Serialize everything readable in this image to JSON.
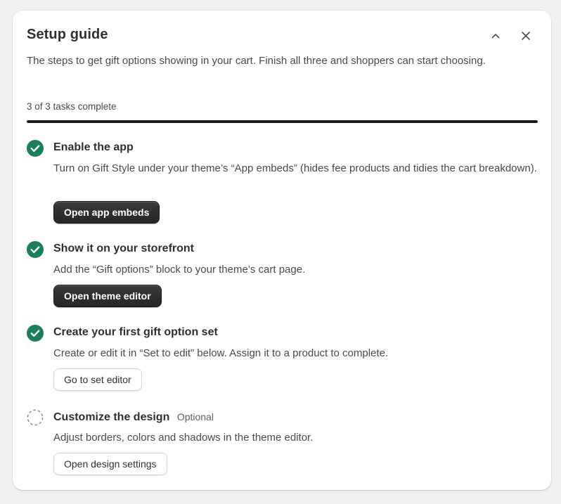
{
  "header": {
    "title": "Setup guide",
    "subtitle": "The steps to get gift options showing in your cart. Finish all three and shoppers can start choosing.",
    "collapse_icon": "chevron-up-icon",
    "close_icon": "close-icon"
  },
  "progress": {
    "label": "3 of 3 tasks complete",
    "completed": 3,
    "total": 3,
    "fraction": 1.0
  },
  "tasks": [
    {
      "title": "Enable the app",
      "description": "Turn on Gift Style under your theme’s “App embeds” (hides fee products and tidies the cart breakdown).",
      "button_label": "Open app embeds",
      "status": "complete"
    },
    {
      "title": "Show it on your storefront",
      "description": "Add the “Gift options” block to your theme’s cart page.",
      "button_label": "Open theme editor",
      "status": "complete"
    },
    {
      "title": "Create your first gift option set",
      "description": "Create or edit it in “Set to edit” below. Assign it to a product to complete.",
      "button_label": "Go to set editor",
      "status": "complete"
    },
    {
      "title": "Customize the design",
      "optional_label": "Optional",
      "description": "Adjust borders, colors and shadows in the theme editor.",
      "button_label": "Open design settings",
      "status": "incomplete"
    }
  ],
  "colors": {
    "check": "#1a7f5a",
    "primary_button": "#303030",
    "progress_fill": "#1a1a1a",
    "background": "#f1f1f1"
  }
}
